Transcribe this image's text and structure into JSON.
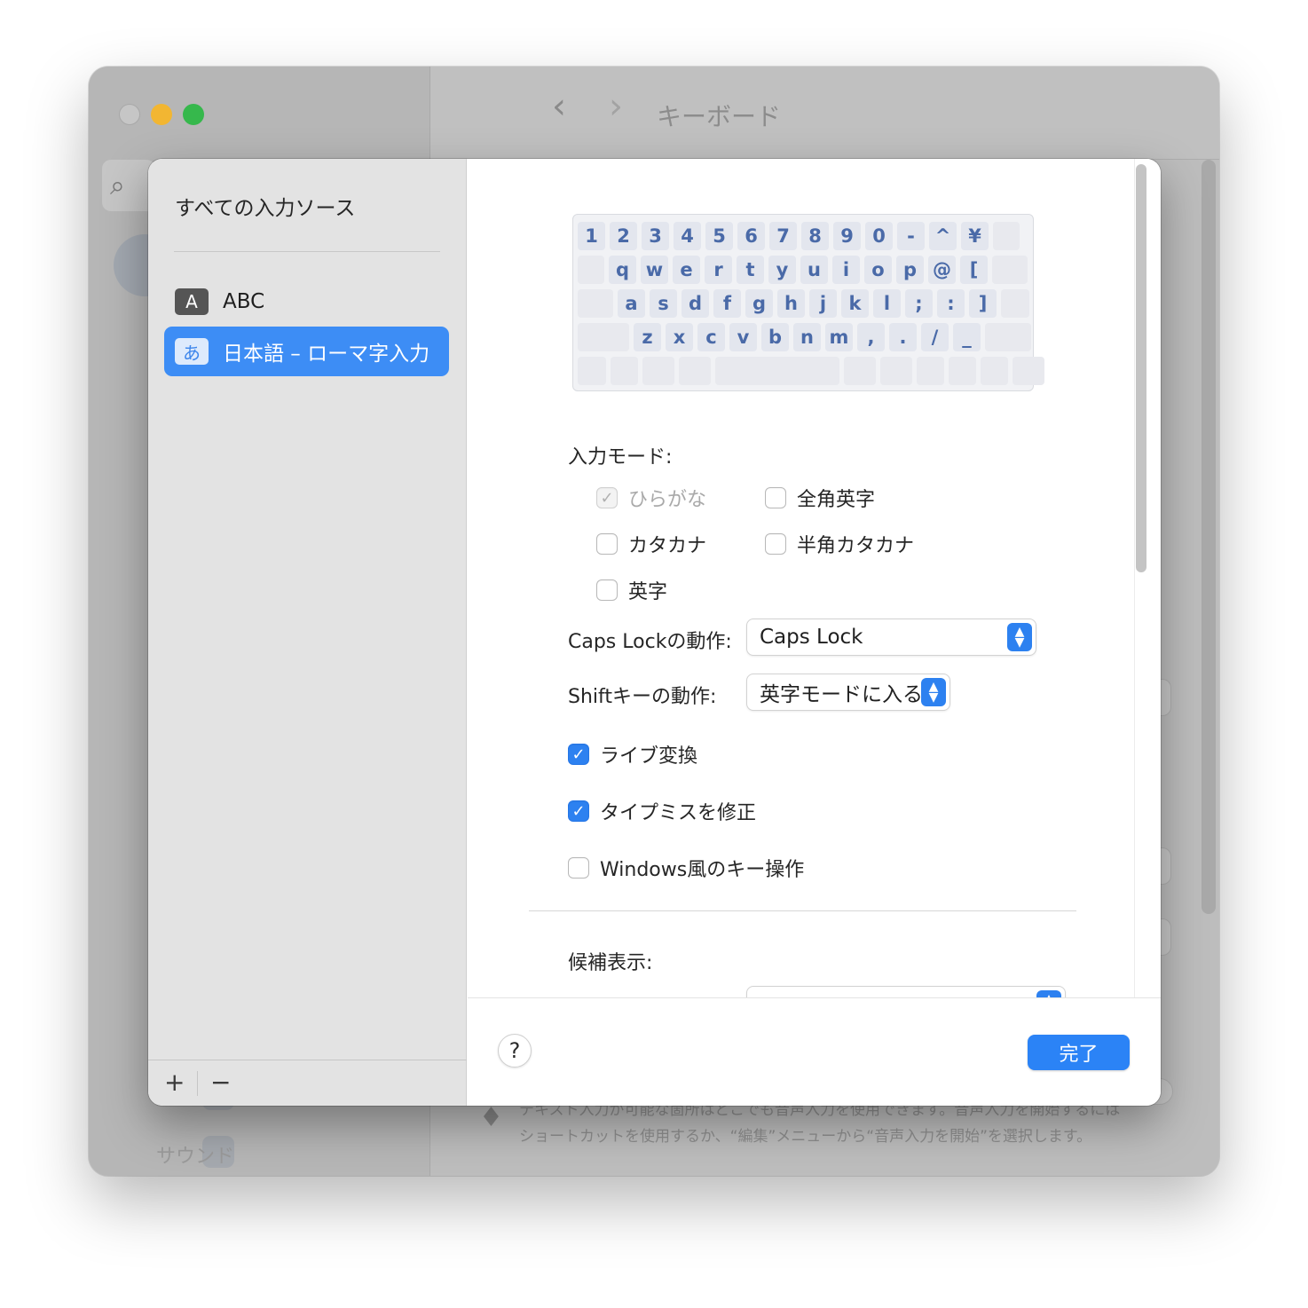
{
  "background_window": {
    "title": "キーボード",
    "nav_back": "‹",
    "nav_forward": "›",
    "sidebar_partial_item": "サウンド",
    "dictation_text_line1": "テキスト入力が可能な箇所はどこでも音声入力を使用できます。音声入力を開始するには",
    "dictation_text_line2": "ショートカットを使用するか、“編集”メニューから“音声入力を開始”を選択します。"
  },
  "sheet": {
    "sidebar": {
      "header": "すべての入力ソース",
      "sources": [
        {
          "badge": "A",
          "label": "ABC",
          "selected": false
        },
        {
          "badge": "あ",
          "label": "日本語 – ローマ字入力",
          "selected": true
        }
      ],
      "add_label": "+",
      "remove_label": "−"
    },
    "keyboard": {
      "row1": [
        "1",
        "2",
        "3",
        "4",
        "5",
        "6",
        "7",
        "8",
        "9",
        "0",
        "-",
        "^",
        "¥"
      ],
      "row2": [
        "q",
        "w",
        "e",
        "r",
        "t",
        "y",
        "u",
        "i",
        "o",
        "p",
        "@",
        "["
      ],
      "row3": [
        "a",
        "s",
        "d",
        "f",
        "g",
        "h",
        "j",
        "k",
        "l",
        ";",
        ":",
        "]"
      ],
      "row4": [
        "z",
        "x",
        "c",
        "v",
        "b",
        "n",
        "m",
        ",",
        ".",
        "/",
        "_"
      ]
    },
    "input_mode": {
      "label": "入力モード:",
      "options": [
        {
          "label": "ひらがな",
          "checked": true,
          "disabled": true
        },
        {
          "label": "全角英字",
          "checked": false,
          "disabled": false
        },
        {
          "label": "カタカナ",
          "checked": false,
          "disabled": false
        },
        {
          "label": "半角カタカナ",
          "checked": false,
          "disabled": false
        },
        {
          "label": "英字",
          "checked": false,
          "disabled": false
        }
      ]
    },
    "caps_lock": {
      "label": "Caps Lockの動作:",
      "value": "Caps Lock"
    },
    "shift_key": {
      "label": "Shiftキーの動作:",
      "value": "英字モードに入る"
    },
    "toggles": [
      {
        "label": "ライブ変換",
        "checked": true
      },
      {
        "label": "タイプミスを修正",
        "checked": true
      },
      {
        "label": "Windows風のキー操作",
        "checked": false
      }
    ],
    "candidates": {
      "label": "候補表示:"
    },
    "footer": {
      "help_label": "?",
      "done_label": "完了"
    }
  },
  "colors": {
    "accent": "#2b83f6",
    "selected_row": "#3d8df5",
    "key_text": "#4a6aa8"
  }
}
